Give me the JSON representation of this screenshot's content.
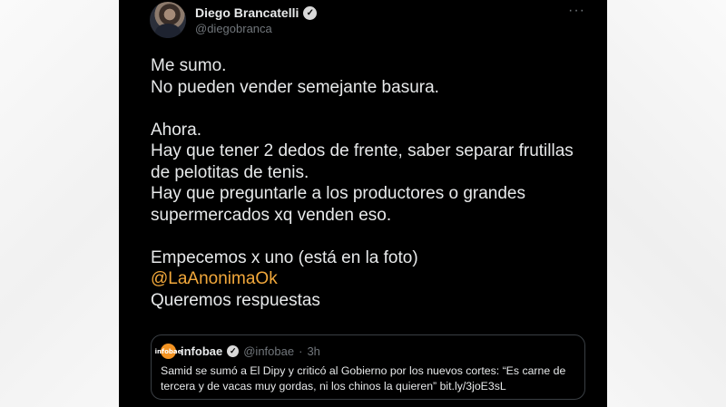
{
  "tweet": {
    "author": {
      "display_name": "Diego Brancatelli",
      "handle": "@diegobranca"
    },
    "more_icon": "more-horizontal-icon",
    "lines": [
      "Me sumo.",
      "No pueden vender semejante basura.",
      "",
      "Ahora.",
      "Hay que tener 2 dedos de frente, saber separar frutillas",
      "de pelotitas de tenis.",
      "Hay que preguntarle a los productores o grandes",
      "supermercados xq venden eso.",
      "",
      "Empecemos x uno (está en la foto)",
      "@LaAnonimaOk",
      "Queremos respuestas"
    ],
    "mention_color": "#f2a83b"
  },
  "quote": {
    "logo_text": "infobae",
    "name": "infobae",
    "handle": "@infobae",
    "separator": "·",
    "time": "3h",
    "text": "Samid se sumó a El Dipy y criticó al Gobierno por los nuevos cortes: “Es carne de tercera y de vacas muy gordas, ni los chinos la quieren” bit.ly/3joE3sL"
  }
}
